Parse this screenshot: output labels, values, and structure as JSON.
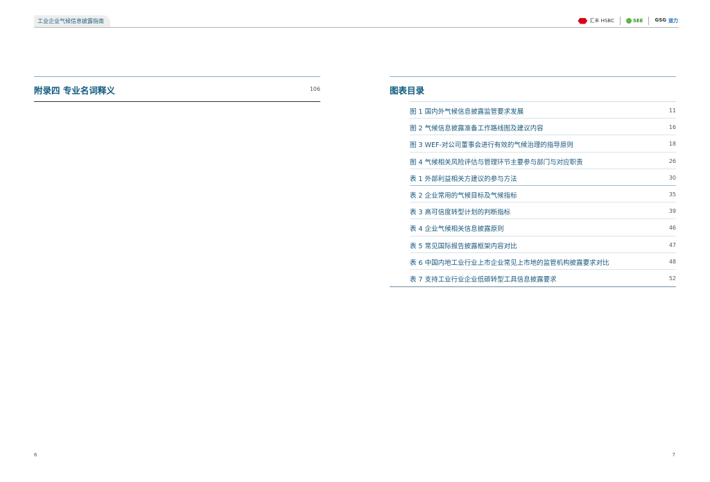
{
  "header": {
    "tab_title": "工业企业气候信息披露指南",
    "logos": {
      "hsbc": "汇丰 HSBC",
      "see": "SEE",
      "gsg": "GSG",
      "gsg_cn": "道力"
    }
  },
  "left": {
    "title": "附录四 专业名词释义",
    "page": "106"
  },
  "right": {
    "title": "图表目录",
    "items": [
      {
        "label": "图 1 国内外气候信息披露监管要求发展",
        "page": "11"
      },
      {
        "label": "图 2 气候信息披露准备工作路线图及建议内容",
        "page": "16"
      },
      {
        "label": "图 3 WEF-对公司董事会进行有效的气候治理的指导原则",
        "page": "18"
      },
      {
        "label": "图 4 气候相关风险评估与管理环节主要参与部门与对应职责",
        "page": "26"
      },
      {
        "label": "表 1 外部利益相关方建议的参与方法",
        "page": "30"
      },
      {
        "label": "表 2 企业常用的气候目标及气候指标",
        "page": "35"
      },
      {
        "label": "表 3 高可信度转型计划的判断指标",
        "page": "39"
      },
      {
        "label": "表 4 企业气候相关信息披露原则",
        "page": "46"
      },
      {
        "label": "表 5 常见国际报告披露框架内容对比",
        "page": "47"
      },
      {
        "label": "表 6 中国内地工业行业上市企业常见上市地的监管机构披露要求对比",
        "page": "48"
      },
      {
        "label": "表 7 支持工业行业企业低碳转型工具信息披露要求",
        "page": "52"
      }
    ]
  },
  "footer": {
    "left_page": "6",
    "right_page": "7"
  }
}
